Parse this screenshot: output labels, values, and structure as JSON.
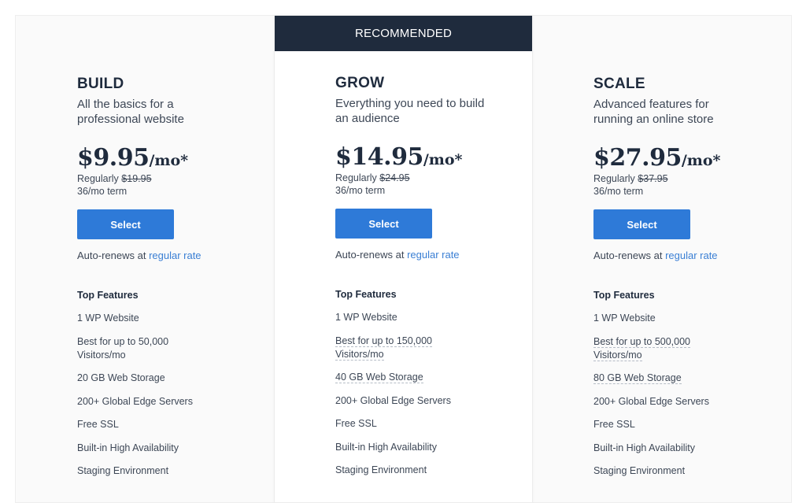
{
  "recommended_label": "RECOMMENDED",
  "plans": [
    {
      "name": "BUILD",
      "description": "All the basics for a professional website",
      "price": "$9.95",
      "price_suffix": "/mo*",
      "regular_prefix": "Regularly",
      "regular_price": "$19.95",
      "term": "36/mo term",
      "select_label": "Select",
      "auto_renew_text": "Auto-renews at",
      "auto_renew_link": "regular rate",
      "features_title": "Top Features",
      "features": [
        {
          "line1": "1 WP Website",
          "line2": "",
          "dotted": false
        },
        {
          "line1": "Best for up to 50,000",
          "line2": "Visitors/mo",
          "dotted": false
        },
        {
          "line1": "20 GB Web Storage",
          "line2": "",
          "dotted": false
        },
        {
          "line1": "200+ Global Edge Servers",
          "line2": "",
          "dotted": false
        },
        {
          "line1": "Free SSL",
          "line2": "",
          "dotted": false
        },
        {
          "line1": "Built-in High Availability",
          "line2": "",
          "dotted": false
        },
        {
          "line1": "Staging Environment",
          "line2": "",
          "dotted": false
        }
      ]
    },
    {
      "name": "GROW",
      "description": "Everything you need to build an audience",
      "price": "$14.95",
      "price_suffix": "/mo*",
      "regular_prefix": "Regularly",
      "regular_price": "$24.95",
      "term": "36/mo term",
      "select_label": "Select",
      "auto_renew_text": "Auto-renews at",
      "auto_renew_link": "regular rate",
      "features_title": "Top Features",
      "features": [
        {
          "line1": "1 WP Website",
          "line2": "",
          "dotted": false
        },
        {
          "line1": "Best for up to 150,000",
          "line2": "Visitors/mo",
          "dotted": true
        },
        {
          "line1": "40 GB Web Storage",
          "line2": "",
          "dotted": true
        },
        {
          "line1": "200+ Global Edge Servers",
          "line2": "",
          "dotted": false
        },
        {
          "line1": "Free SSL",
          "line2": "",
          "dotted": false
        },
        {
          "line1": "Built-in High Availability",
          "line2": "",
          "dotted": false
        },
        {
          "line1": "Staging Environment",
          "line2": "",
          "dotted": false
        }
      ]
    },
    {
      "name": "SCALE",
      "description": "Advanced features for running an online store",
      "price": "$27.95",
      "price_suffix": "/mo*",
      "regular_prefix": "Regularly",
      "regular_price": "$37.95",
      "term": "36/mo term",
      "select_label": "Select",
      "auto_renew_text": "Auto-renews at",
      "auto_renew_link": "regular rate",
      "features_title": "Top Features",
      "features": [
        {
          "line1": "1 WP Website",
          "line2": "",
          "dotted": false
        },
        {
          "line1": "Best for up to 500,000",
          "line2": "Visitors/mo",
          "dotted": true
        },
        {
          "line1": "80 GB Web Storage",
          "line2": "",
          "dotted": true
        },
        {
          "line1": "200+ Global Edge Servers",
          "line2": "",
          "dotted": false
        },
        {
          "line1": "Free SSL",
          "line2": "",
          "dotted": false
        },
        {
          "line1": "Built-in High Availability",
          "line2": "",
          "dotted": false
        },
        {
          "line1": "Staging Environment",
          "line2": "",
          "dotted": false
        }
      ]
    }
  ],
  "colors": {
    "banner_bg": "#1f2b3d",
    "button_bg": "#2e7ad8",
    "link": "#3a7fd4",
    "text_dark": "#1f2b3d"
  }
}
